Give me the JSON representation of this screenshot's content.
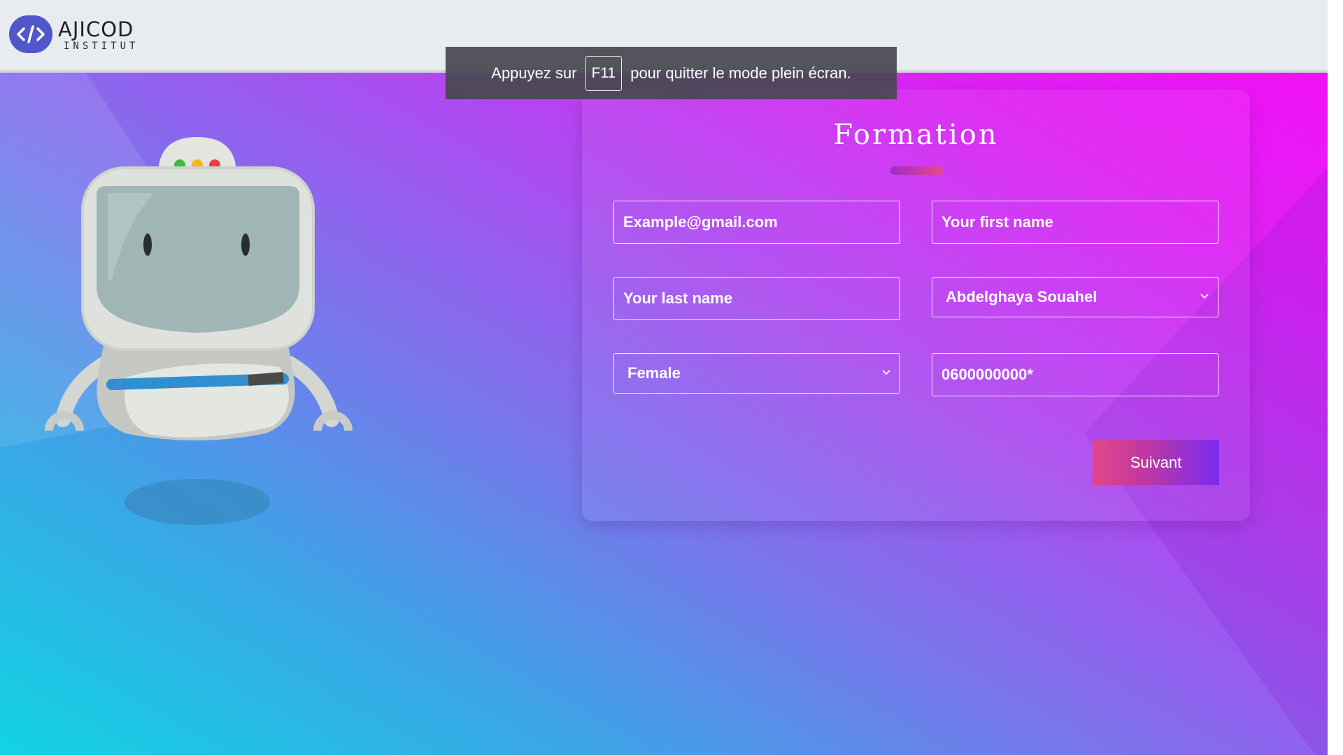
{
  "header": {
    "brand_name": "AJICOD",
    "brand_sub": "INSTITUT",
    "logo_icon": "code-brackets-icon"
  },
  "fullscreen_notice": {
    "before": "Appuyez sur",
    "key": "F11",
    "after": "pour quitter le mode plein écran."
  },
  "form": {
    "title": "Formation",
    "fields": {
      "email": {
        "placeholder": "Example@gmail.com"
      },
      "first_name": {
        "placeholder": "Your first name"
      },
      "last_name": {
        "placeholder": "Your last name"
      },
      "trainer_select": {
        "selected": "Abdelghaya Souahel"
      },
      "gender_select": {
        "selected": "Female"
      },
      "phone": {
        "placeholder": "0600000000*"
      }
    },
    "submit_label": "Suivant"
  },
  "colors": {
    "gradient_start": "#12d3e3",
    "gradient_end": "#f80cf6",
    "button_start": "#e34687",
    "button_end": "#7a2cf0",
    "logo_badge": "#4f57c9"
  },
  "illustration": {
    "name": "robot-mascot",
    "lights": [
      "#43b54a",
      "#f5b71b",
      "#e8403a"
    ]
  }
}
